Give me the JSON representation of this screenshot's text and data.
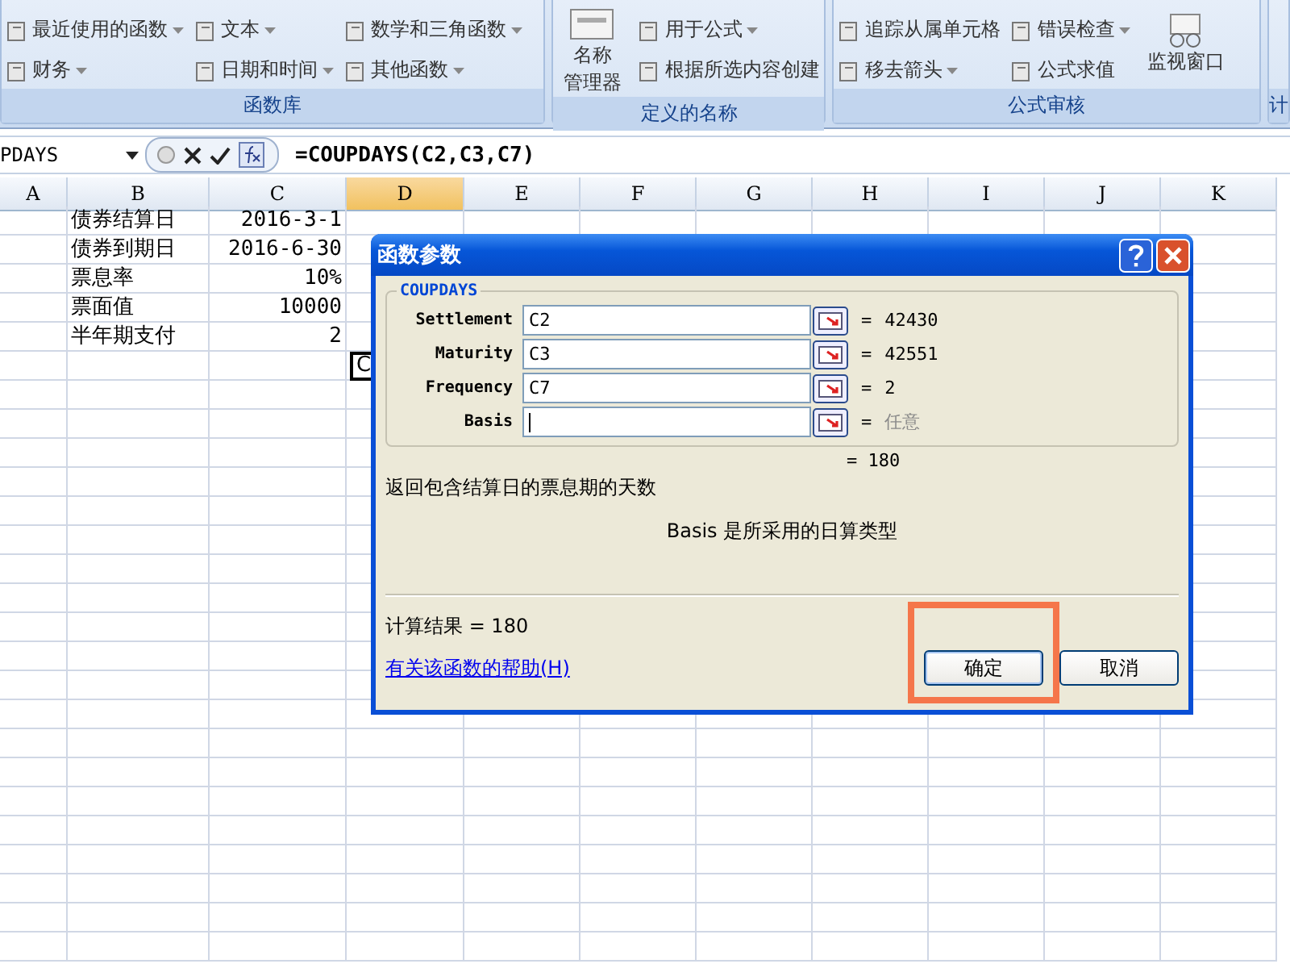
{
  "ribbon": {
    "groups": [
      {
        "label": "函数库",
        "columns": [
          [
            {
              "label": "最近使用的函数",
              "dropdown": true
            },
            {
              "label": "财务",
              "dropdown": true
            }
          ],
          [
            {
              "label": "文本",
              "dropdown": true
            },
            {
              "label": "日期和时间",
              "dropdown": true
            }
          ],
          [
            {
              "label": "数学和三角函数",
              "dropdown": true
            },
            {
              "label": "其他函数",
              "dropdown": true
            }
          ]
        ]
      },
      {
        "label": "定义的名称",
        "big": {
          "lines": [
            "名称",
            "管理器"
          ]
        },
        "columns": [
          [
            {
              "label": "用于公式",
              "dropdown": true
            },
            {
              "label": "根据所选内容创建",
              "dropdown": false
            }
          ]
        ]
      },
      {
        "label": "公式审核",
        "columns": [
          [
            {
              "label": "追踪从属单元格",
              "dropdown": false
            },
            {
              "label": "移去箭头",
              "dropdown": true
            }
          ],
          [
            {
              "label": "错误检查",
              "dropdown": true
            },
            {
              "label": "公式求值",
              "dropdown": false
            }
          ]
        ],
        "big": {
          "lines": [
            "监视窗口"
          ]
        }
      },
      {
        "label": "计"
      }
    ]
  },
  "formula_bar": {
    "name_box": "PDAYS",
    "formula": "=COUPDAYS(C2,C3,C7)"
  },
  "sheet": {
    "columns": [
      {
        "label": "A",
        "selected": false
      },
      {
        "label": "B",
        "selected": false
      },
      {
        "label": "C",
        "selected": false
      },
      {
        "label": "D",
        "selected": true
      },
      {
        "label": "E",
        "selected": false
      },
      {
        "label": "F",
        "selected": false
      },
      {
        "label": "G",
        "selected": false
      },
      {
        "label": "H",
        "selected": false
      },
      {
        "label": "I",
        "selected": false
      },
      {
        "label": "J",
        "selected": false
      },
      {
        "label": "K",
        "selected": false
      }
    ],
    "rows": [
      {
        "label": "债券结算日",
        "value": "2016-3-1"
      },
      {
        "label": "债券到期日",
        "value": "2016-6-30"
      },
      {
        "label": "票息率",
        "value": "10%"
      },
      {
        "label": "票面值",
        "value": "10000"
      },
      {
        "label": "半年期支付",
        "value": "2"
      }
    ],
    "active_cell": "C"
  },
  "dialog": {
    "title": "函数参数",
    "function": "COUPDAYS",
    "args": [
      {
        "name": "Settlement",
        "value": "C2",
        "eq": "=",
        "result": "42430",
        "greyed": false,
        "focused": false
      },
      {
        "name": "Maturity",
        "value": "C3",
        "eq": "=",
        "result": "42551",
        "greyed": false,
        "focused": false
      },
      {
        "name": "Frequency",
        "value": "C7",
        "eq": "=",
        "result": "2",
        "greyed": false,
        "focused": false
      },
      {
        "name": "Basis",
        "eq": "=",
        "result": "任意",
        "greyed": true,
        "focused": true
      }
    ],
    "total": "= 180",
    "description": "返回包含结算日的票息期的天数",
    "arg_help": "Basis  是所采用的日算类型",
    "computed": "计算结果 =  180",
    "help_link": "有关该函数的帮助(H)",
    "buttons": [
      {
        "label": "确定",
        "highlighted": true
      },
      {
        "label": "取消",
        "highlighted": false
      }
    ]
  }
}
